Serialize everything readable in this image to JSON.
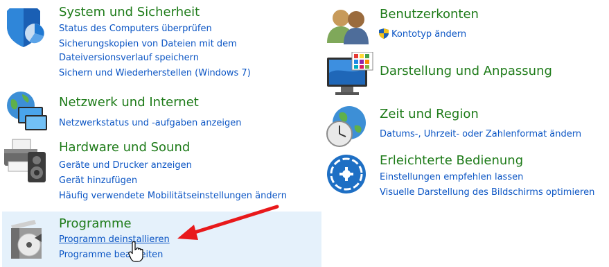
{
  "categories": {
    "system": {
      "title": "System und Sicherheit",
      "links": [
        "Status des Computers überprüfen",
        "Sicherungskopien von Dateien mit dem",
        "Dateiversionsverlauf speichern",
        "Sichern und Wiederherstellen (Windows 7)"
      ],
      "icon": "shield-icon"
    },
    "network": {
      "title": "Netzwerk und Internet",
      "links": [
        "Netzwerkstatus und -aufgaben anzeigen"
      ],
      "icon": "network-globe-icon"
    },
    "hardware": {
      "title": "Hardware und Sound",
      "links": [
        "Geräte und Drucker anzeigen",
        "Gerät hinzufügen",
        "Häufig verwendete Mobilitätseinstellungen ändern"
      ],
      "icon": "printer-speaker-icon"
    },
    "programs": {
      "title": "Programme",
      "links": [
        "Programm deinstallieren",
        "Programme bearbeiten"
      ],
      "icon": "programs-box-icon"
    },
    "users": {
      "title": "Benutzerkonten",
      "links": [
        "Kontotyp ändern"
      ],
      "icon": "users-icon"
    },
    "appearance": {
      "title": "Darstellung und Anpassung",
      "links": [],
      "icon": "monitor-palette-icon"
    },
    "time": {
      "title": "Zeit und Region",
      "links": [
        "Datums-, Uhrzeit- oder Zahlenformat ändern"
      ],
      "icon": "clock-globe-icon"
    },
    "ease": {
      "title": "Erleichterte Bedienung",
      "links": [
        "Einstellungen empfehlen lassen",
        "Visuelle Darstellung des Bildschirms optimieren"
      ],
      "icon": "ease-of-access-icon"
    }
  },
  "colors": {
    "title_green": "#1e7b19",
    "link_blue": "#0b55c4",
    "hover_bg": "#e5f1fb",
    "arrow_red": "#e8191b"
  }
}
